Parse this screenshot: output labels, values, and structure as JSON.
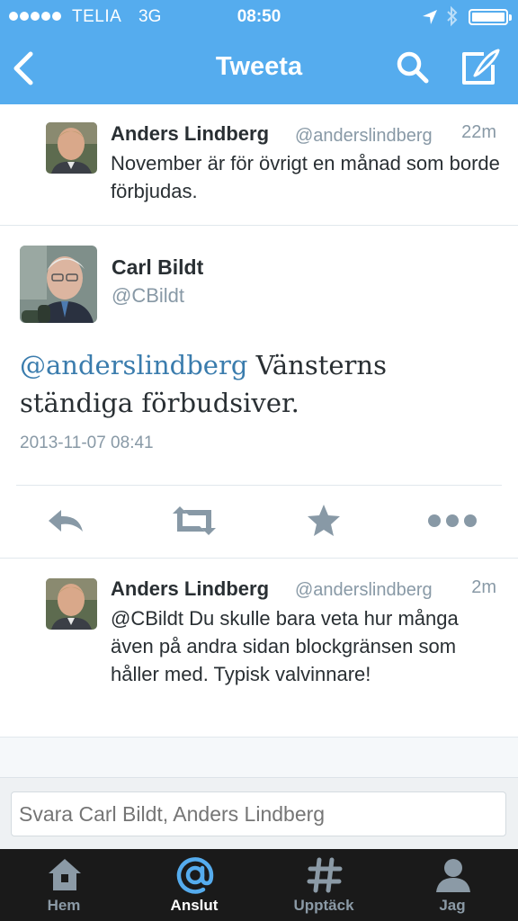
{
  "status_bar": {
    "carrier": "TELIA",
    "network": "3G",
    "time": "08:50"
  },
  "nav": {
    "title": "Tweeta",
    "icons": [
      "back-chevron-icon",
      "search-icon",
      "compose-icon"
    ]
  },
  "tweets": {
    "previous": {
      "name": "Anders Lindberg",
      "handle": "@anderslindberg",
      "time": "22m",
      "text": "November är för övrigt en månad som borde förbjudas."
    },
    "main": {
      "name": "Carl Bildt",
      "handle": "@CBildt",
      "mention": "@anderslindberg",
      "text": " Vänsterns ständiga förbudsiver.",
      "date": "2013-11-07 08:41",
      "actions": [
        "reply-icon",
        "retweet-icon",
        "favorite-star-icon",
        "more-dots-icon"
      ]
    },
    "reply": {
      "name": "Anders Lindberg",
      "handle": "@anderslindberg",
      "time": "2m",
      "text": "@CBildt Du skulle bara veta hur många även på andra sidan blockgränsen som håller med. Typisk valvinnare!"
    }
  },
  "reply_box": {
    "placeholder": "Svara Carl Bildt, Anders Lindberg"
  },
  "tabbar": {
    "tabs": [
      {
        "label": "Hem",
        "icon": "home-icon"
      },
      {
        "label": "Anslut",
        "icon": "at-sign-icon",
        "active": true
      },
      {
        "label": "Upptäck",
        "icon": "hashtag-icon"
      },
      {
        "label": "Jag",
        "icon": "person-icon"
      }
    ]
  },
  "colors": {
    "nav_bg": "#55acee",
    "mention": "#3a7cad",
    "secondary_text": "#8899a6",
    "tabbar_bg": "#1a1a1a",
    "active_tab": "#55acee"
  }
}
